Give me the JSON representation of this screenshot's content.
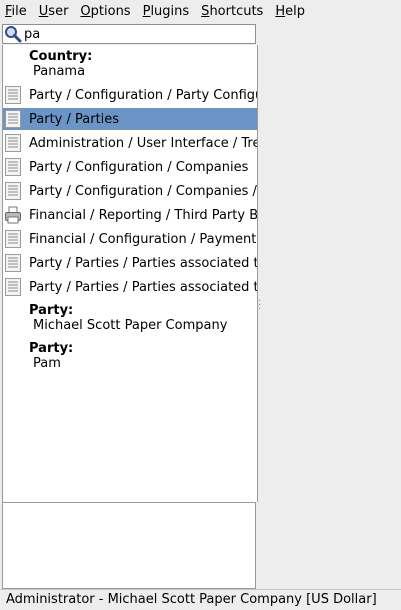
{
  "menu": [
    {
      "mnemonic": "F",
      "rest": "ile"
    },
    {
      "mnemonic": "U",
      "rest": "ser"
    },
    {
      "mnemonic": "O",
      "rest": "ptions"
    },
    {
      "mnemonic": "P",
      "rest": "lugins"
    },
    {
      "mnemonic": "S",
      "rest": "hortcuts"
    },
    {
      "mnemonic": "H",
      "rest": "elp"
    }
  ],
  "search": {
    "value": "pa",
    "icon": "search-icon"
  },
  "groups": {
    "country": {
      "title": "Country:",
      "value": "Panama"
    },
    "party1": {
      "title": "Party:",
      "value": "Michael Scott Paper Company"
    },
    "party2": {
      "title": "Party:",
      "value": "Pam"
    }
  },
  "results": [
    {
      "label": "Party / Configuration / Party Configuration",
      "icon": "document-icon"
    },
    {
      "label": "Party / Parties",
      "icon": "document-icon",
      "selected": true
    },
    {
      "label": "Administration / User Interface / Tree",
      "icon": "document-icon"
    },
    {
      "label": "Party / Configuration / Companies",
      "icon": "document-icon"
    },
    {
      "label": "Party / Configuration / Companies / ",
      "icon": "document-icon"
    },
    {
      "label": "Financial / Reporting / Third Party Balance",
      "icon": "printer-icon"
    },
    {
      "label": "Financial / Configuration / Payment",
      "icon": "document-icon"
    },
    {
      "label": "Party / Parties / Parties associated to",
      "icon": "document-icon"
    },
    {
      "label": "Party / Parties / Parties associated to",
      "icon": "document-icon"
    }
  ],
  "status": "Administrator - Michael Scott Paper Company [US Dollar]",
  "colors": {
    "selection": "#6a95c6",
    "background": "#ededed"
  }
}
